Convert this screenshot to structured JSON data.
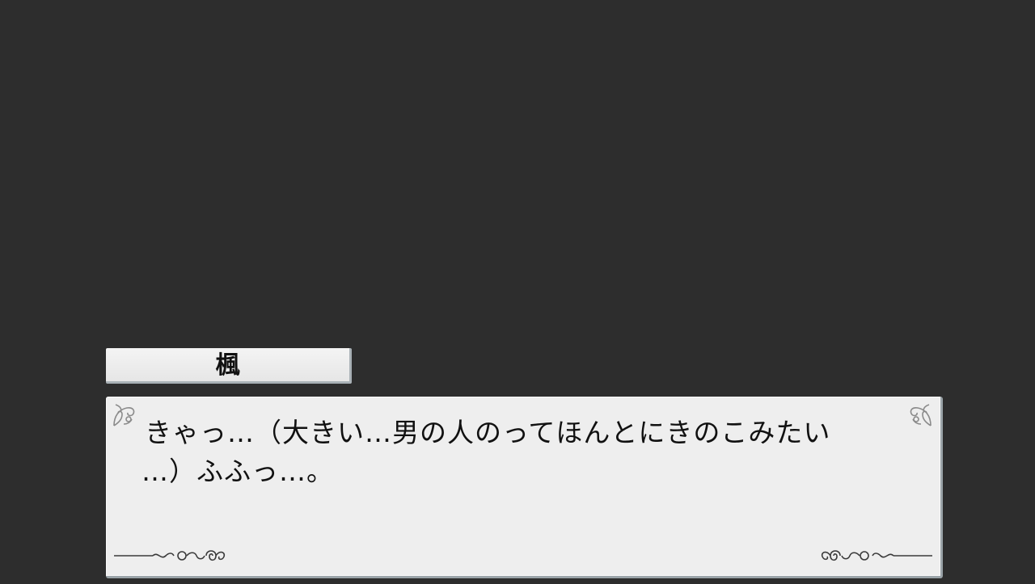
{
  "dialogue": {
    "speaker_name": "楓",
    "line1": "きゃっ…（大きい…男の人のってほんとにきのこみたい",
    "line2": "…）ふふっ…。"
  },
  "decorations": {
    "corner_ornament": "filigree-ornament",
    "bottom_flourish": "scroll-flourish"
  },
  "colors": {
    "background": "#2d2d2d",
    "panel": "#eeeeee",
    "text": "#111111",
    "panel_shadow": "#9aa3a8"
  }
}
